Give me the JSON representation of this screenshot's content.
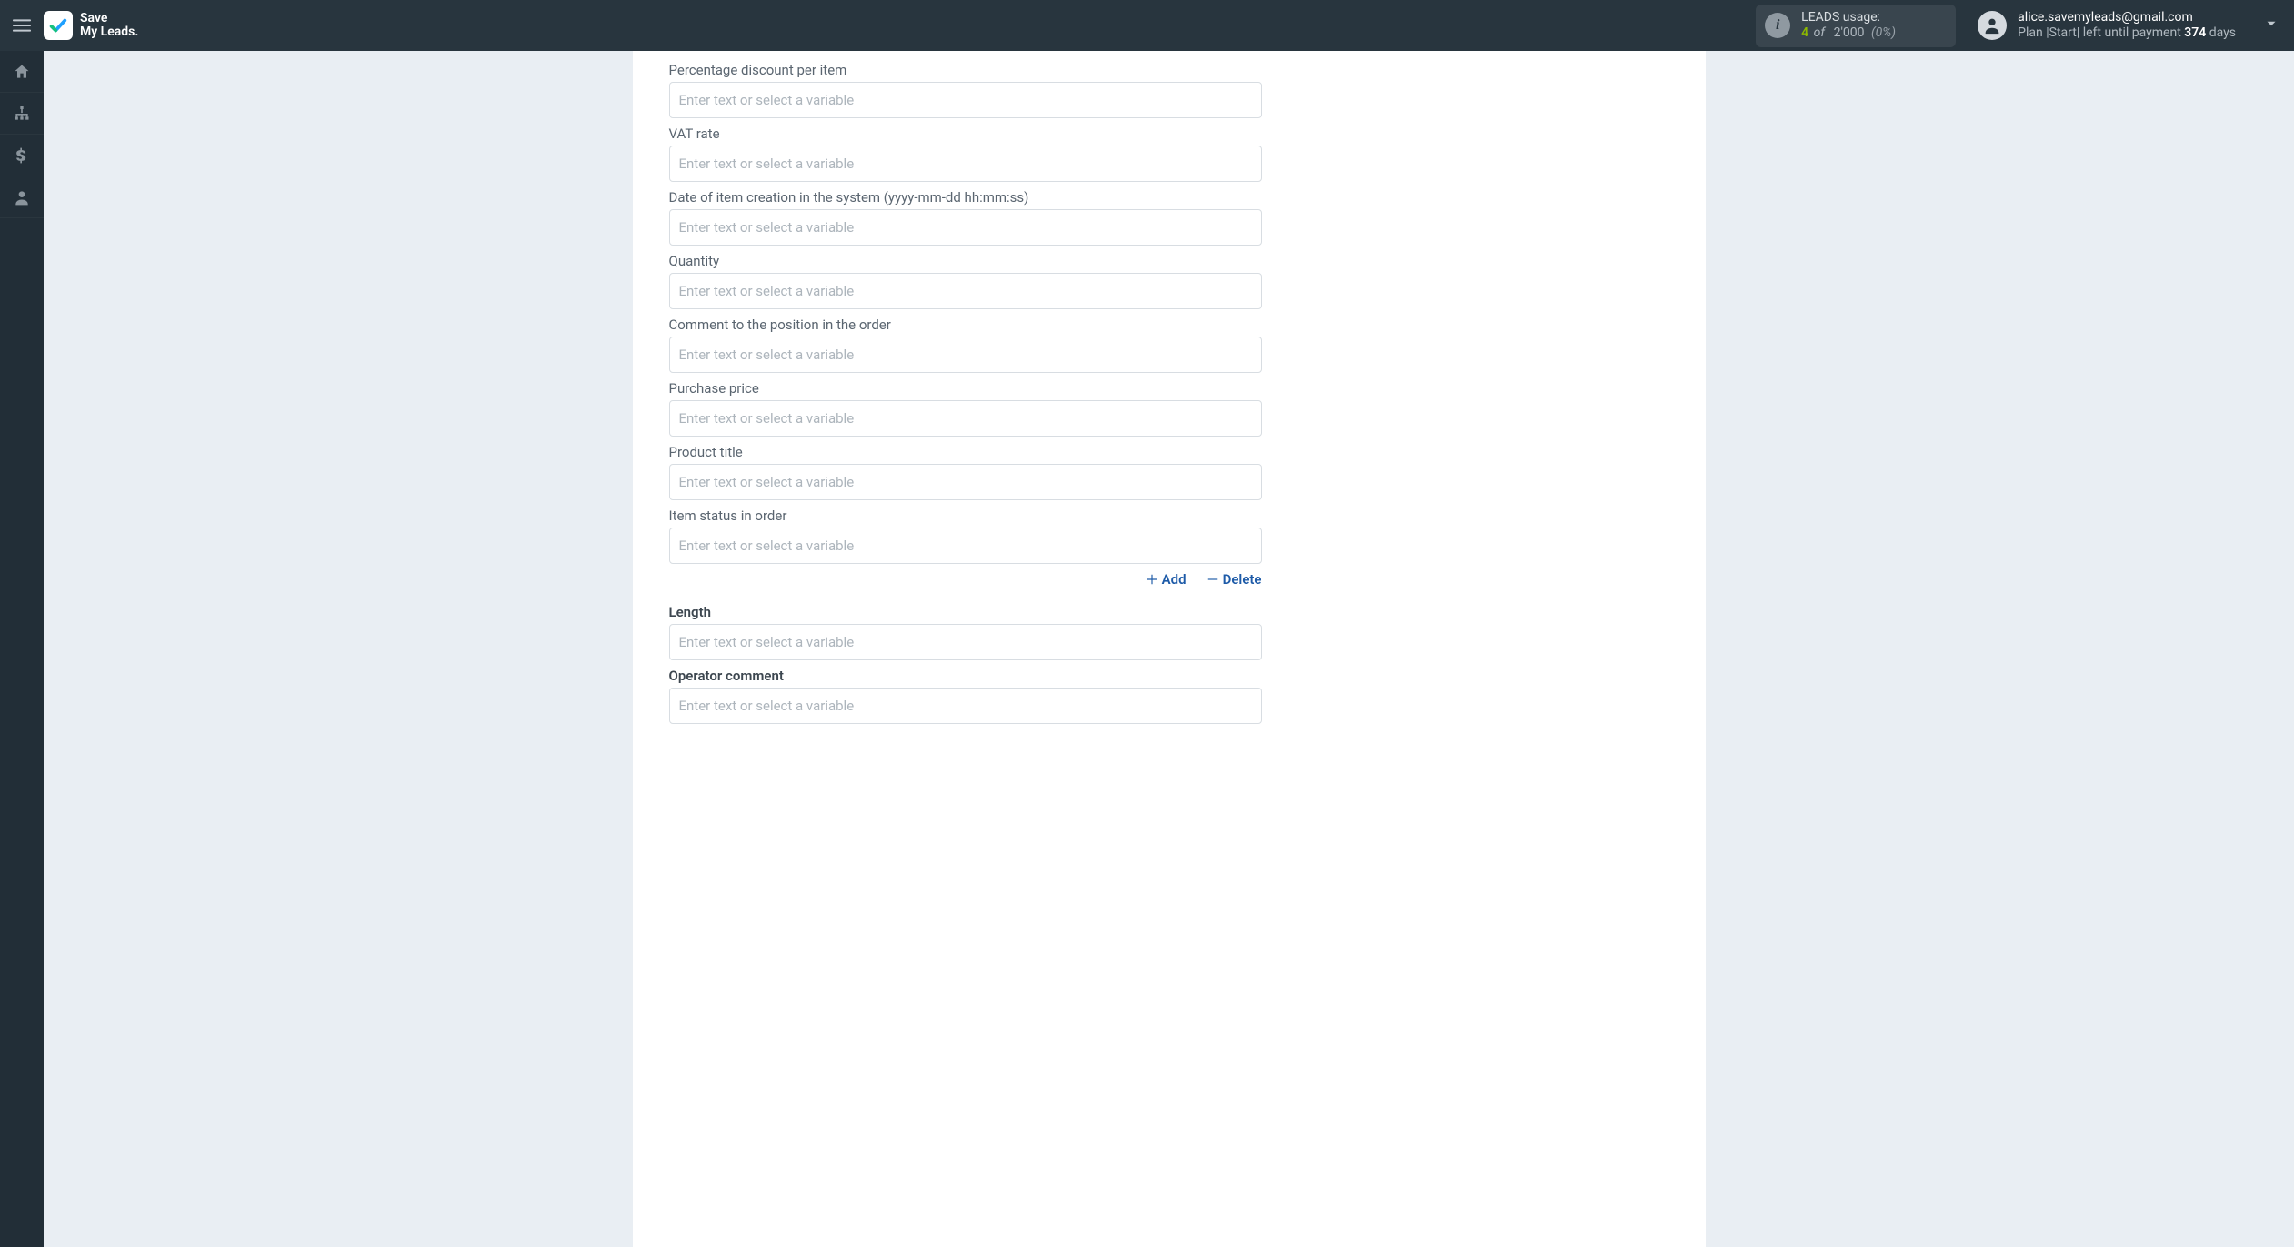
{
  "brand": {
    "line1": "Save",
    "line2": "My Leads."
  },
  "usage": {
    "title": "LEADS usage:",
    "value": "4",
    "of": "of",
    "total": "2'000",
    "percent": "(0%)"
  },
  "account": {
    "email": "alice.savemyleads@gmail.com",
    "plan_prefix": "Plan |Start| left until payment ",
    "days": "374",
    "days_suffix": " days"
  },
  "placeholder": "Enter text or select a variable",
  "fields": [
    {
      "key": "percentage_discount",
      "label": "Percentage discount per item",
      "bold": false
    },
    {
      "key": "vat_rate",
      "label": "VAT rate",
      "bold": false
    },
    {
      "key": "created_at",
      "label": "Date of item creation in the system (yyyy-mm-dd hh:mm:ss)",
      "bold": false
    },
    {
      "key": "quantity",
      "label": "Quantity",
      "bold": false
    },
    {
      "key": "position_comment",
      "label": "Comment to the position in the order",
      "bold": false
    },
    {
      "key": "purchase_price",
      "label": "Purchase price",
      "bold": false
    },
    {
      "key": "product_title",
      "label": "Product title",
      "bold": false
    },
    {
      "key": "item_status",
      "label": "Item status in order",
      "bold": false
    }
  ],
  "actions": {
    "add": "Add",
    "delete": "Delete"
  },
  "fields2": [
    {
      "key": "length",
      "label": "Length",
      "bold": true
    },
    {
      "key": "operator_comment",
      "label": "Operator comment",
      "bold": true
    }
  ]
}
